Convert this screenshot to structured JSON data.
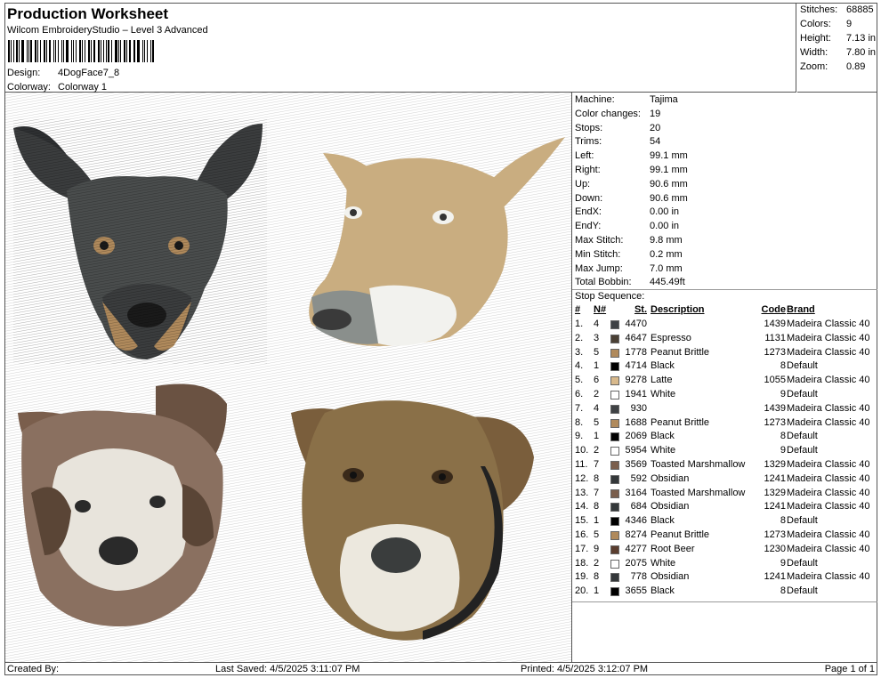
{
  "header": {
    "title": "Production Worksheet",
    "software": "Wilcom EmbroideryStudio – Level 3 Advanced",
    "design_label": "Design:",
    "design_value": "4DogFace7_8",
    "colorway_label": "Colorway:",
    "colorway_value": "Colorway 1"
  },
  "summary": [
    {
      "label": "Stitches:",
      "value": "68885"
    },
    {
      "label": "Colors:",
      "value": "9"
    },
    {
      "label": "Height:",
      "value": "7.13 in"
    },
    {
      "label": "Width:",
      "value": "7.80 in"
    },
    {
      "label": "Zoom:",
      "value": "0.89"
    }
  ],
  "machine": [
    {
      "label": "Machine:",
      "value": "Tajima"
    },
    {
      "label": "Color changes:",
      "value": "19"
    },
    {
      "label": "Stops:",
      "value": "20"
    },
    {
      "label": "Trims:",
      "value": "54"
    },
    {
      "label": "Left:",
      "value": "99.1 mm"
    },
    {
      "label": "Right:",
      "value": "99.1 mm"
    },
    {
      "label": "Up:",
      "value": "90.6 mm"
    },
    {
      "label": "Down:",
      "value": "90.6 mm"
    },
    {
      "label": "EndX:",
      "value": "0.00 in"
    },
    {
      "label": "EndY:",
      "value": "0.00 in"
    },
    {
      "label": "Max Stitch:",
      "value": "9.8 mm"
    },
    {
      "label": "Min Stitch:",
      "value": "0.2 mm"
    },
    {
      "label": "Max Jump:",
      "value": "7.0 mm"
    },
    {
      "label": "Total Bobbin:",
      "value": "445.49ft"
    }
  ],
  "stop_sequence": {
    "title": "Stop Sequence:",
    "headers": {
      "num": "#",
      "n": "N#",
      "st": "St.",
      "desc": "Description",
      "code": "Code",
      "brand": "Brand"
    },
    "rows": [
      {
        "num": "1.",
        "n": "4",
        "color": "#3f4245",
        "st": "4470",
        "desc": "",
        "code": "1439",
        "brand": "Madeira Classic 40"
      },
      {
        "num": "2.",
        "n": "3",
        "color": "#4a4035",
        "st": "4647",
        "desc": "Espresso",
        "code": "1131",
        "brand": "Madeira Classic 40"
      },
      {
        "num": "3.",
        "n": "5",
        "color": "#b08a5c",
        "st": "1778",
        "desc": "Peanut Brittle",
        "code": "1273",
        "brand": "Madeira Classic 40"
      },
      {
        "num": "4.",
        "n": "1",
        "color": "#000000",
        "st": "4714",
        "desc": "Black",
        "code": "8",
        "brand": "Default"
      },
      {
        "num": "5.",
        "n": "6",
        "color": "#d8b98c",
        "st": "9278",
        "desc": "Latte",
        "code": "1055",
        "brand": "Madeira Classic 40"
      },
      {
        "num": "6.",
        "n": "2",
        "color": "#ffffff",
        "st": "1941",
        "desc": "White",
        "code": "9",
        "brand": "Default"
      },
      {
        "num": "7.",
        "n": "4",
        "color": "#3f4245",
        "st": "930",
        "desc": "",
        "code": "1439",
        "brand": "Madeira Classic 40"
      },
      {
        "num": "8.",
        "n": "5",
        "color": "#b08a5c",
        "st": "1688",
        "desc": "Peanut Brittle",
        "code": "1273",
        "brand": "Madeira Classic 40"
      },
      {
        "num": "9.",
        "n": "1",
        "color": "#000000",
        "st": "2069",
        "desc": "Black",
        "code": "8",
        "brand": "Default"
      },
      {
        "num": "10.",
        "n": "2",
        "color": "#ffffff",
        "st": "5954",
        "desc": "White",
        "code": "9",
        "brand": "Default"
      },
      {
        "num": "11.",
        "n": "7",
        "color": "#7a5e4c",
        "st": "3569",
        "desc": "Toasted Marshmallow",
        "code": "1329",
        "brand": "Madeira Classic 40"
      },
      {
        "num": "12.",
        "n": "8",
        "color": "#34383a",
        "st": "592",
        "desc": "Obsidian",
        "code": "1241",
        "brand": "Madeira Classic 40"
      },
      {
        "num": "13.",
        "n": "7",
        "color": "#7a5e4c",
        "st": "3164",
        "desc": "Toasted Marshmallow",
        "code": "1329",
        "brand": "Madeira Classic 40"
      },
      {
        "num": "14.",
        "n": "8",
        "color": "#34383a",
        "st": "684",
        "desc": "Obsidian",
        "code": "1241",
        "brand": "Madeira Classic 40"
      },
      {
        "num": "15.",
        "n": "1",
        "color": "#000000",
        "st": "4346",
        "desc": "Black",
        "code": "8",
        "brand": "Default"
      },
      {
        "num": "16.",
        "n": "5",
        "color": "#b08a5c",
        "st": "8274",
        "desc": "Peanut Brittle",
        "code": "1273",
        "brand": "Madeira Classic 40"
      },
      {
        "num": "17.",
        "n": "9",
        "color": "#5a3d2e",
        "st": "4277",
        "desc": "Root Beer",
        "code": "1230",
        "brand": "Madeira Classic 40"
      },
      {
        "num": "18.",
        "n": "2",
        "color": "#ffffff",
        "st": "2075",
        "desc": "White",
        "code": "9",
        "brand": "Default"
      },
      {
        "num": "19.",
        "n": "8",
        "color": "#34383a",
        "st": "778",
        "desc": "Obsidian",
        "code": "1241",
        "brand": "Madeira Classic 40"
      },
      {
        "num": "20.",
        "n": "1",
        "color": "#000000",
        "st": "3655",
        "desc": "Black",
        "code": "8",
        "brand": "Default"
      }
    ]
  },
  "footer": {
    "created_by": "Created By:",
    "last_saved": "Last Saved: 4/5/2025 3:11:07 PM",
    "printed": "Printed: 4/5/2025 3:12:07 PM",
    "page": "Page 1 of 1"
  },
  "preview": {
    "colors": {
      "black_tan_dog": "#3b3d3e",
      "tan": "#b08a5c",
      "light_tan_dog": "#c9ad80",
      "white": "#f2f2ee",
      "brown_fur": "#7a5e4c",
      "obsidian": "#34383a",
      "root_beer": "#5a3d2e",
      "olive_brown_dog": "#8a7048"
    }
  }
}
